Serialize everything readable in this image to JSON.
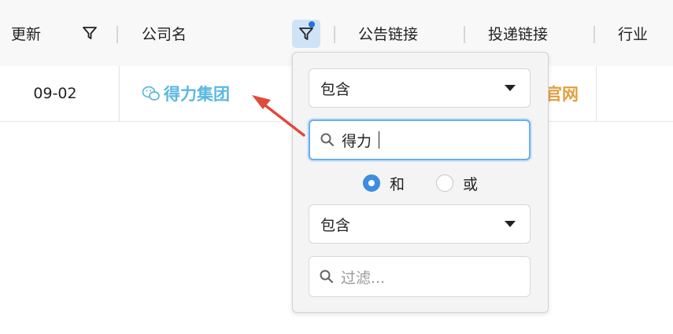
{
  "header": {
    "col_updated": "更新",
    "col_company": "公司名",
    "col_announcement_link": "公告链接",
    "col_delivery_link": "投递链接",
    "col_industry": "行业"
  },
  "row": {
    "date": "09-02",
    "company": "得力集团",
    "delivery_link_text": "官网"
  },
  "filter_popup": {
    "condition1": "包含",
    "search1_value": "得力",
    "radio_and": "和",
    "radio_or": "或",
    "radio_selected": "和",
    "condition2": "包含",
    "search2_placeholder": "过滤..."
  },
  "colors": {
    "link_blue": "#5bb8e0",
    "link_orange": "#e0a040",
    "accent": "#3d8de0",
    "annotation_arrow": "#e04a3a"
  },
  "icons": [
    "filter-icon",
    "wechat-icon",
    "search-icon",
    "dropdown-triangle-icon"
  ]
}
